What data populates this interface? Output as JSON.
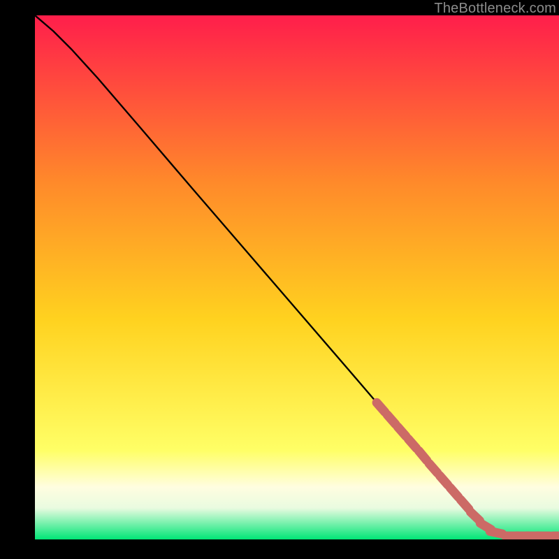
{
  "watermark": "TheBottleneck.com",
  "colors": {
    "gradient_top": "#ff1e4b",
    "gradient_q1": "#ff8a2a",
    "gradient_mid": "#ffd21f",
    "gradient_q3_a": "#fffde0",
    "gradient_q3_b": "#e9fbe0",
    "gradient_bottom": "#00e676",
    "curve": "#000000",
    "marker": "#cc6a66",
    "background": "#000000"
  },
  "chart_data": {
    "type": "line",
    "title": "",
    "xlabel": "",
    "ylabel": "",
    "xlim": [
      0,
      100
    ],
    "ylim": [
      0,
      100
    ],
    "grid": false,
    "legend_position": "none",
    "series": [
      {
        "name": "bottleneck_curve",
        "x": [
          0,
          3.5,
          7,
          12,
          20,
          30,
          40,
          50,
          60,
          66,
          68,
          70,
          72,
          74,
          76,
          78,
          80,
          82,
          84,
          86,
          88,
          90,
          91,
          93,
          95,
          97,
          100
        ],
        "y": [
          100,
          97,
          93.5,
          88,
          78.7,
          67,
          55.4,
          43.8,
          32.2,
          25.2,
          22.9,
          20.6,
          18.3,
          16,
          13.6,
          11.3,
          9,
          6.7,
          4.4,
          2.5,
          1.3,
          0.65,
          0.65,
          0.65,
          0.65,
          0.65,
          0.65
        ]
      }
    ],
    "markers": {
      "name": "observed_points",
      "x": [
        66,
        68,
        70,
        72,
        74,
        76,
        78,
        80,
        82,
        84,
        86,
        88,
        91,
        93,
        95,
        97,
        100
      ],
      "y": [
        25.2,
        22.9,
        20.6,
        18.3,
        16,
        13.6,
        11.3,
        9,
        6.7,
        4.4,
        2.5,
        1.3,
        0.65,
        0.65,
        0.65,
        0.65,
        0.65
      ]
    }
  }
}
